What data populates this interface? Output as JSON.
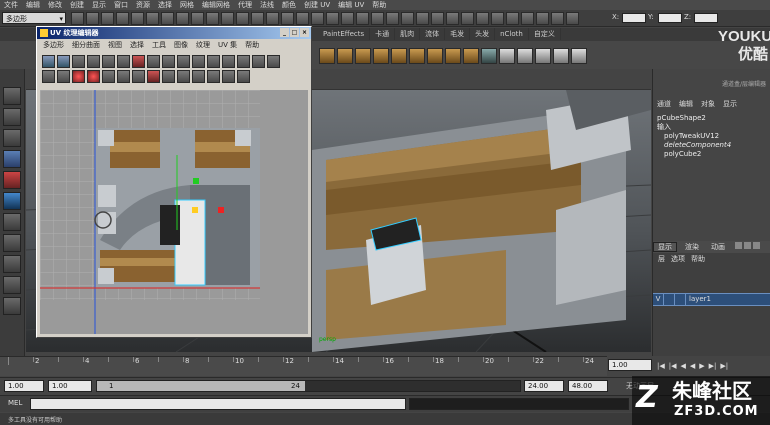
{
  "menubar": [
    "文件",
    "编辑",
    "修改",
    "创建",
    "显示",
    "窗口",
    "资源",
    "选择",
    "网格",
    "编辑网格",
    "代理",
    "法线",
    "颜色",
    "创建 UV",
    "编辑 UV",
    "帮助"
  ],
  "mode_dropdown": "多边形",
  "coords": {
    "x_label": "X:",
    "y_label": "Y:",
    "z_label": "Z:"
  },
  "shelf_tabs": [
    "PaintEffects",
    "卡通",
    "肌肉",
    "流体",
    "毛发",
    "头发",
    "nCloth",
    "自定义"
  ],
  "watermark": {
    "brand": "YOUKU",
    "brand_cn": "优酷"
  },
  "uv_editor": {
    "title": "UV 纹理编辑器",
    "menus": [
      "多边形",
      "细分曲面",
      "视图",
      "选择",
      "工具",
      "图像",
      "纹理",
      "UV 集",
      "帮助"
    ]
  },
  "viewport_label": "persp",
  "channel_box": {
    "header": "通道盒/层编辑器",
    "menus": [
      "通道",
      "编辑",
      "对象",
      "显示"
    ],
    "shape": "pCubeShape2",
    "input_label": "输入",
    "inputs": [
      "polyTweakUV12",
      "deleteComponent4",
      "polyCube2"
    ]
  },
  "layer_editor": {
    "tabs": [
      "显示",
      "渲染",
      "动画"
    ],
    "menus": [
      "层",
      "选项",
      "帮助"
    ],
    "layer_visible": "V",
    "layer_name": "layer1"
  },
  "timeline": {
    "ticks": [
      "2",
      "4",
      "6",
      "8",
      "10",
      "12",
      "14",
      "16",
      "18",
      "20",
      "22",
      "24"
    ],
    "current_frame": "1.00"
  },
  "range": {
    "start": "1.00",
    "start2": "1.00",
    "slider_start": "1",
    "slider_end": "24",
    "end": "24.00",
    "end2": "48.00",
    "anim_layer": "无动画层"
  },
  "command": {
    "label": "MEL"
  },
  "help_line": "多工具没有可用帮助",
  "logo": {
    "cn": "朱峰社区",
    "url": "ZF3D.COM"
  },
  "colors": {
    "maya_bg": "#444444",
    "uv_window": "#d4d0c8",
    "titlebar": "#0a246a",
    "accent": "#39c"
  }
}
